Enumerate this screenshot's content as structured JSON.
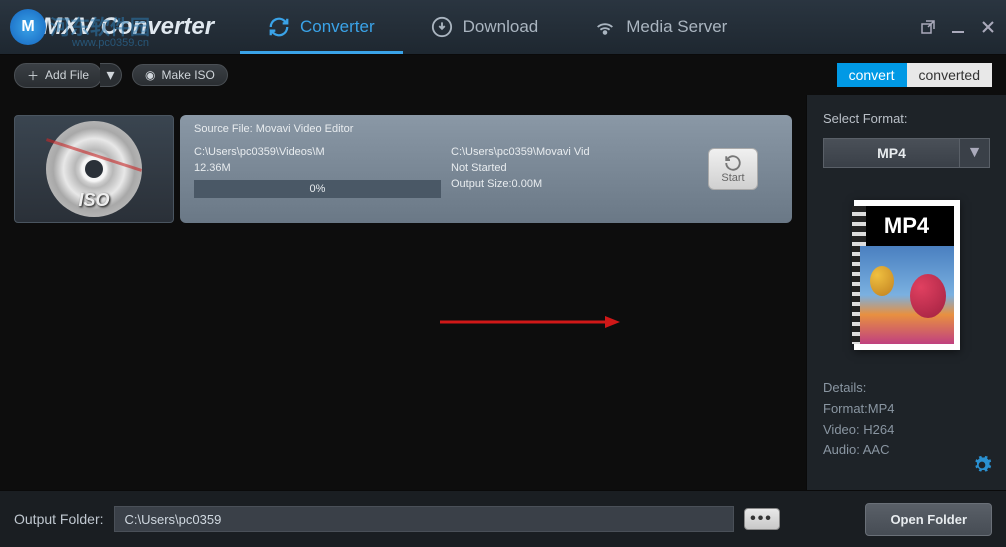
{
  "app": {
    "name": "MXV Converter",
    "logo_badge": "M"
  },
  "watermark": {
    "text": "河东软件园",
    "url": "www.pc0359.cn"
  },
  "tabs": {
    "converter": "Converter",
    "download": "Download",
    "media_server": "Media Server"
  },
  "toolbar": {
    "add_file": "Add File",
    "make_iso": "Make ISO",
    "convert_tab": "convert",
    "converted_tab": "converted"
  },
  "file": {
    "thumb_label": "ISO",
    "source_line": "Source File: Movavi Video Editor",
    "input_path": "C:\\Users\\pc0359\\Videos\\M",
    "size": "12.36M",
    "output_path": "C:\\Users\\pc0359\\Movavi Vid",
    "status": "Not Started",
    "output_size": "Output Size:0.00M",
    "progress": "0%",
    "start": "Start"
  },
  "sidebar": {
    "select_format": "Select Format:",
    "format": "MP4",
    "preview_label": "MP4",
    "details_heading": "Details:",
    "detail_format": "Format:MP4",
    "detail_video": "Video: H264",
    "detail_audio": "Audio: AAC"
  },
  "footer": {
    "label": "Output Folder:",
    "path": "C:\\Users\\pc0359",
    "browse": "•••",
    "open_folder": "Open Folder"
  }
}
